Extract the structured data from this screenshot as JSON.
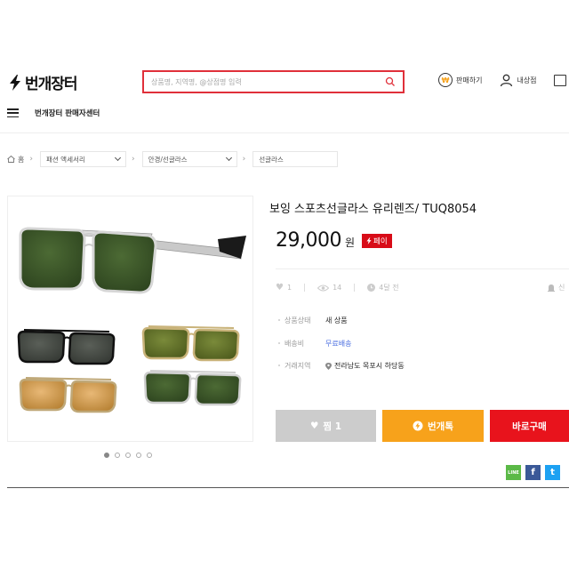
{
  "header": {
    "logo_text": "번개장터",
    "search_placeholder": "상품명, 지역명, @상점명 입력",
    "sell_label": "판매하기",
    "sell_icon": "won-coin-icon",
    "my_shop_label": "내상점",
    "menu_title": "번개장터 판매자센터"
  },
  "breadcrumb": {
    "home_label": "홈",
    "levels": [
      "패션 액세서리",
      "안경/선글라스",
      "선글라스"
    ]
  },
  "product": {
    "title": "보잉 스포츠선글라스 유리렌즈/ TUQ8054",
    "price": "29,000",
    "currency": "원",
    "pay_badge": "페이",
    "likes": "1",
    "views": "14",
    "posted": "4달 전",
    "report_label": "신",
    "details": [
      {
        "label": "상품상태",
        "value": "새 상품"
      },
      {
        "label": "배송비",
        "value": "무료배송"
      },
      {
        "label": "거래지역",
        "value": "전라남도 목포시 하당동"
      }
    ],
    "image_count": 5,
    "active_image_index": 0
  },
  "actions": {
    "like_label": "찜 1",
    "chat_label": "번개톡",
    "buy_label": "바로구매"
  },
  "share": {
    "line_label": "LINE",
    "facebook_label": "f",
    "twitter_label": "t"
  },
  "colors": {
    "brand_red": "#e8131c",
    "search_border": "#e0303a",
    "chat_orange": "#f7a21b",
    "free_ship_blue": "#4a6ee0"
  }
}
